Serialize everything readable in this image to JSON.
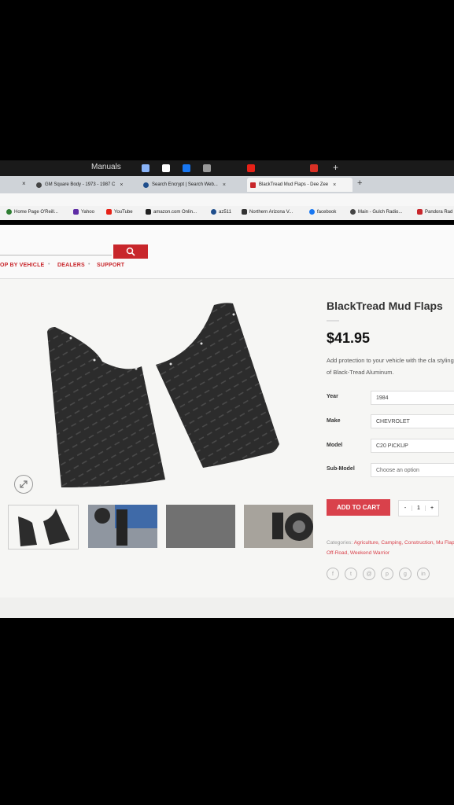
{
  "taskbar": {
    "label": "Manuals"
  },
  "tabs": [
    {
      "label": "GM Square Body - 1973 - 1987 C",
      "close": "×"
    },
    {
      "label": "Search Encrypt | Search Web...",
      "close": "×"
    },
    {
      "label": "BlackTread Mud Flaps - Dee Zee",
      "close": "×"
    }
  ],
  "new_tab": "+",
  "first_tab_close": "×",
  "bookmarks": [
    {
      "label": "Home Page O'Reill...",
      "color": "#2e7d32"
    },
    {
      "label": "Yahoo",
      "color": "#5e2ca5"
    },
    {
      "label": "YouTube",
      "color": "#e62117"
    },
    {
      "label": "amazon.com Onlin...",
      "color": "#222222"
    },
    {
      "label": "az511",
      "color": "#1f4e8c"
    },
    {
      "label": "Northern Arizona V...",
      "color": "#333333"
    },
    {
      "label": "facebook",
      "color": "#1877f2"
    },
    {
      "label": "Main - Gulch Radio...",
      "color": "#444444"
    },
    {
      "label": "Pandora Rad",
      "color": "#c8262b"
    }
  ],
  "nav": {
    "shop_by_vehicle": "OP BY VEHICLE",
    "dealers": "DEALERS",
    "support": "SUPPORT",
    "sep": "•"
  },
  "product": {
    "title": "BlackTread Mud Flaps",
    "price": "$41.95",
    "description": "Add protection to your vehicle with the cla styling of Black-Tread Aluminum.",
    "fields": [
      {
        "label": "Year",
        "value": "1984"
      },
      {
        "label": "Make",
        "value": "CHEVROLET"
      },
      {
        "label": "Model",
        "value": "C20 PICKUP"
      },
      {
        "label": "Sub-Model",
        "value": "Choose an option"
      }
    ],
    "add_to_cart": "ADD TO CART",
    "qty": {
      "minus": "-",
      "value": "1",
      "plus": "+"
    },
    "categories_label": "Categories:",
    "categories": "Agriculture, Camping, Construction, Mu Flaps, Off-Road, Weekend Warrior"
  },
  "colors": {
    "accent": "#c8262b",
    "button": "#d9414b"
  }
}
